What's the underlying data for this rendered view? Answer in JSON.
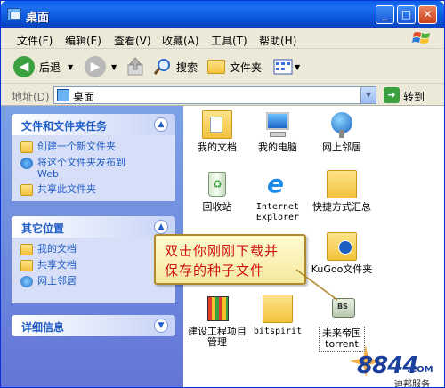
{
  "window": {
    "title": "桌面"
  },
  "menu": [
    "文件(F)",
    "编辑(E)",
    "查看(V)",
    "收藏(A)",
    "工具(T)",
    "帮助(H)"
  ],
  "toolbar": {
    "back": "后退",
    "search": "搜索",
    "folders": "文件夹"
  },
  "address": {
    "label": "地址(D)",
    "value": "桌面",
    "go": "转到"
  },
  "tasks": {
    "title": "文件和文件夹任务",
    "items": [
      {
        "label": "创建一个新文件夹",
        "icon": "new-folder-icon"
      },
      {
        "label": "将这个文件夹发布到 Web",
        "icon": "publish-web-icon"
      },
      {
        "label": "共享此文件夹",
        "icon": "share-folder-icon"
      }
    ]
  },
  "places": {
    "title": "其它位置",
    "items": [
      {
        "label": "我的文档",
        "icon": "my-documents-icon"
      },
      {
        "label": "共享文档",
        "icon": "shared-documents-icon"
      },
      {
        "label": "网上邻居",
        "icon": "network-icon"
      }
    ]
  },
  "details": {
    "title": "详细信息"
  },
  "icons": [
    {
      "label": "我的文档",
      "icon": "my-documents-icon"
    },
    {
      "label": "我的电脑",
      "icon": "my-computer-icon"
    },
    {
      "label": "网上邻居",
      "icon": "network-places-icon"
    },
    {
      "label": "回收站",
      "icon": "recycle-bin-icon"
    },
    {
      "label": "Internet Explorer",
      "icon": "internet-explorer-icon"
    },
    {
      "label": "快捷方式汇总",
      "icon": "folder-icon"
    },
    {
      "label": "KuGoo文件夹",
      "icon": "kugoo-folder-icon"
    },
    {
      "label": "建设工程项目管理",
      "icon": "project-chart-icon"
    },
    {
      "label": "bitspirit",
      "icon": "folder-icon"
    },
    {
      "label": "未来帝国 torrent",
      "icon": "torrent-file-icon"
    }
  ],
  "callout": {
    "line1": "双击你刚刚下载并",
    "line2": "保存的种子文件"
  },
  "watermark": {
    "number": "8844",
    "domain": ".COM",
    "name": "迪邦服务"
  }
}
